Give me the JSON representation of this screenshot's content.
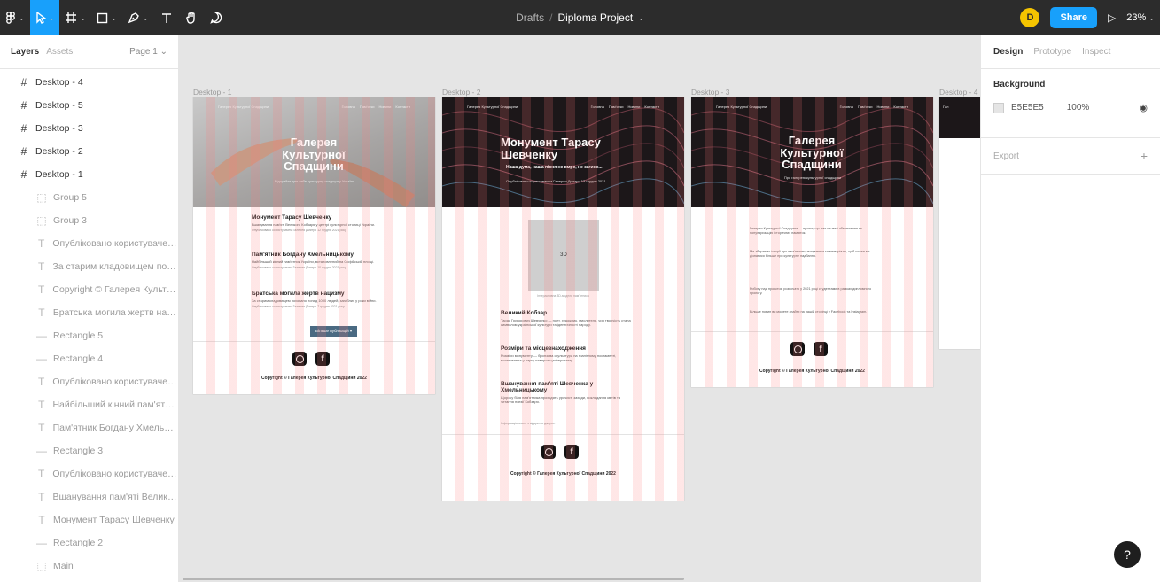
{
  "toolbar": {
    "main_menu_icon": "figma-icon",
    "breadcrumb_folder": "Drafts",
    "breadcrumb_separator": "/",
    "file_name": "Diploma Project",
    "avatar_initial": "D",
    "share_label": "Share",
    "play_glyph": "▷",
    "zoom": "23%"
  },
  "layers_panel": {
    "tab_layers": "Layers",
    "tab_assets": "Assets",
    "page": "Page 1",
    "items": [
      {
        "icon": "#",
        "label": "Desktop - 4",
        "child": false
      },
      {
        "icon": "#",
        "label": "Desktop - 5",
        "child": false
      },
      {
        "icon": "#",
        "label": "Desktop - 3",
        "child": false
      },
      {
        "icon": "#",
        "label": "Desktop - 2",
        "child": false
      },
      {
        "icon": "#",
        "label": "Desktop - 1",
        "child": false
      },
      {
        "icon": "⬚",
        "label": "Group 5",
        "child": true
      },
      {
        "icon": "⬚",
        "label": "Group 3",
        "child": true
      },
      {
        "icon": "T",
        "label": "Опубліковано користувачем ...",
        "child": true
      },
      {
        "icon": "T",
        "label": "За старим кладовищем поко...",
        "child": true
      },
      {
        "icon": "T",
        "label": "Copyright © Галерея Культур...",
        "child": true
      },
      {
        "icon": "T",
        "label": "Братська могила жертв нац...",
        "child": true
      },
      {
        "icon": "—",
        "label": "Rectangle 5",
        "child": true
      },
      {
        "icon": "—",
        "label": "Rectangle 4",
        "child": true
      },
      {
        "icon": "T",
        "label": "Опубліковано користувачем ...",
        "child": true
      },
      {
        "icon": "T",
        "label": "Найбільший кінний пам'ятни...",
        "child": true
      },
      {
        "icon": "T",
        "label": "Пам'ятник Богдану Хмельни...",
        "child": true
      },
      {
        "icon": "—",
        "label": "Rectangle 3",
        "child": true
      },
      {
        "icon": "T",
        "label": "Опубліковано користувачем ...",
        "child": true
      },
      {
        "icon": "T",
        "label": "Вшанування пам'яті Великог...",
        "child": true
      },
      {
        "icon": "T",
        "label": "Монумент Тарасу Шевченку",
        "child": true
      },
      {
        "icon": "—",
        "label": "Rectangle 2",
        "child": true
      },
      {
        "icon": "⬚",
        "label": "Main",
        "child": true
      }
    ]
  },
  "design_panel": {
    "tab_design": "Design",
    "tab_prototype": "Prototype",
    "tab_inspect": "Inspect",
    "background_title": "Background",
    "background_hex": "E5E5E5",
    "background_opacity": "100%",
    "export_title": "Export",
    "help": "?"
  },
  "canvas": {
    "frames": [
      {
        "label": "Desktop - 1",
        "nav_brand": "Галерея Культурної Спадщини",
        "nav_links": [
          "Головна",
          "Пам'ятки",
          "Новини",
          "Контакти"
        ],
        "hero_title": "Галерея Культурної Спадщини",
        "hero_sub": "Відкрийте для себе культурну спадщину України",
        "articles": [
          {
            "title": "Монумент Тарасу Шевченку",
            "text": "Вшанування пам'яті Великого Кобзаря у центрі культурної столиці України.",
            "meta": "Опубліковано користувачем Галерея Дмитро 12 грудня 2021 року"
          },
          {
            "title": "Пам'ятник Богдану Хмельницькому",
            "text": "Найбільший кінний пам'ятник України, встановлений на Софійській площі.",
            "meta": "Опубліковано користувачем Галерея Дмитро 10 грудня 2021 року"
          },
          {
            "title": "Братська могила жертв нацизму",
            "text": "За старим кладовищем поховано понад 1000 людей, загиблих у роки війни.",
            "meta": "Опубліковано користувачем Галерея Дмитро 7 грудня 2021 року"
          }
        ],
        "more_button": "Більше публікацій ▾",
        "copyright": "Copyright © Галерея Культурної Спадщини 2022"
      },
      {
        "label": "Desktop - 2",
        "nav_brand": "Галерея Культурної Спадщини",
        "nav_links": [
          "Головна",
          "Пам'ятки",
          "Новини",
          "Контакти"
        ],
        "hero_title": "Монумент Тарасу Шевченку",
        "hero_quote": "Наша дума, наша пісня не вмре, не загине...",
        "hero_sub": "Опубліковано користувачем Галерея Дмитро 12 грудня 2021",
        "image_placeholder": "3D",
        "image_caption": "Інтерактивна 3D-модель пам'ятника",
        "sections": [
          {
            "title": "Великий Кобзар",
            "text": "Тарас Григорович Шевченко — поет, художник, мислитель, чия творчість стала символом української культури та ідентичності народу."
          },
          {
            "title": "Розміри та місцезнаходження",
            "text": "Розміри монументу — бронзова скульптура на гранітному постаменті, встановлена у парку навпроти університету."
          },
          {
            "title": "Вшанування пам'яті Шевченка у Хмельницькому",
            "text": "Щороку біля пам'ятника проходять урочисті заходи, покладання квітів та читання поезії Кобзаря."
          }
        ],
        "footer_note": "Інформацію взято з відкритих джерел",
        "copyright": "Copyright © Галерея Культурної Спадщини 2022"
      },
      {
        "label": "Desktop - 3",
        "nav_brand": "Галерея Культурної Спадщини",
        "nav_links": [
          "Головна",
          "Пам'ятки",
          "Новини",
          "Контакти"
        ],
        "hero_title": "Галерея Культурної Спадщини",
        "hero_sub": "Про галерею культурної спадщини",
        "paragraphs": [
          "Галерея Культурної Спадщини — проєкт, що має на меті збереження та популяризацію історичних пам'яток.",
          "Ми збираємо історії про пам'ятники, монументи та меморіали, щоб кожен міг дізнатися більше про культурне надбання.",
          "Роботу над проєктом розпочато у 2021 році студентами в рамках дипломного проєкту.",
          "Більше новин ви можете знайти на нашій сторінці у Facebook та Instagram."
        ],
        "copyright": "Copyright © Галерея Культурної Спадщини 2022"
      },
      {
        "label": "Desktop - 4",
        "nav_brand": "Гал"
      }
    ]
  }
}
